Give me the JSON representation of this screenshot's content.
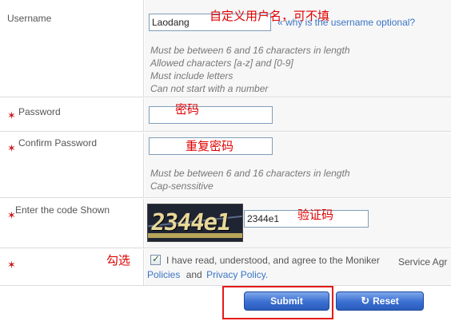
{
  "username": {
    "label": "Username",
    "value": "Laodang",
    "annotation": "自定义用户名，可不填",
    "optional_link": "« why is the username optional?",
    "hints": [
      "Must be between 6 and 16 characters in length",
      "Allowed characters [a-z] and [0-9]",
      "Must include letters",
      "Can not start with a number"
    ]
  },
  "password": {
    "label": "Password",
    "required_mark": "✶",
    "value": "",
    "annotation": "密码"
  },
  "confirm_password": {
    "label": "Confirm Password",
    "required_mark": "✶",
    "value": "",
    "annotation": "重复密码",
    "hints": [
      "Must be between 6 and 16 characters in length",
      "Cap-senssitive"
    ]
  },
  "captcha": {
    "label": "Enter the code Shown",
    "required_mark": "✶",
    "image_text": "2344e1",
    "value": "2344e1",
    "annotation": "验证码"
  },
  "agreement": {
    "required_mark": "✶",
    "annotation": "勾选",
    "checked": true,
    "text_before": "I have read, understood, and agree to the Moniker",
    "service_link": "Service Agr",
    "policies_link": "Policies",
    "and_text": "and",
    "privacy_link": "Privacy Policy."
  },
  "buttons": {
    "submit": "Submit",
    "reset": "Reset",
    "reset_icon": "refresh-icon"
  },
  "colors": {
    "annotation": "#e00000",
    "link": "#3a75c4",
    "button": "#3a6fd1",
    "required": "#cc1b1b"
  }
}
